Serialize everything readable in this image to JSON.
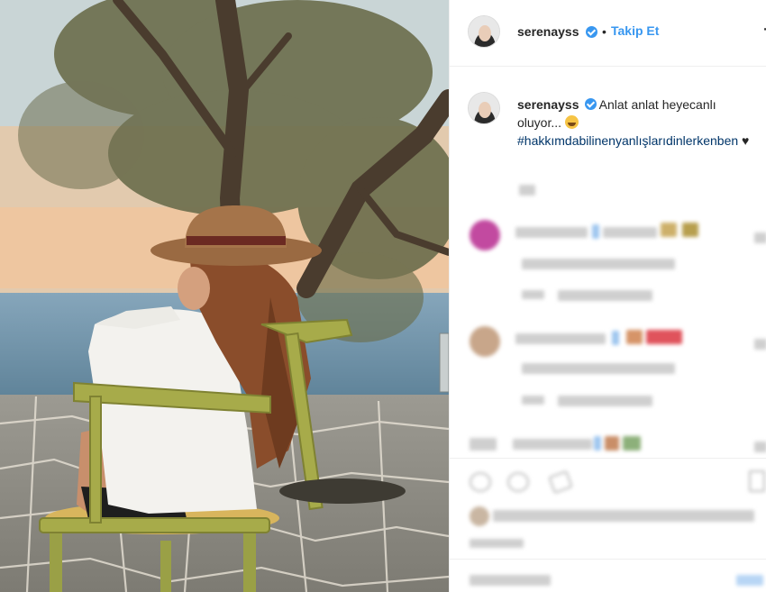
{
  "post": {
    "username": "serenayss",
    "follow_label": "Takip Et",
    "separator": "•",
    "more_icon": "ellipsis-icon"
  },
  "caption": {
    "username": "serenayss",
    "text": "Anlat anlat heyecanlı oluyor...",
    "hashtag": "#hakkımdabilinenyanlışlarıdinlerkenben",
    "heart": "♥"
  },
  "colors": {
    "link": "#3897f0",
    "hashtag": "#003569",
    "verified": "#3897f0"
  }
}
